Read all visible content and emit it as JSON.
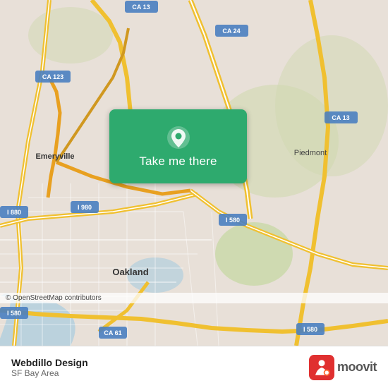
{
  "map": {
    "attribution": "© OpenStreetMap contributors",
    "region": "Oakland / SF Bay Area"
  },
  "button": {
    "label": "Take me there",
    "pin_icon": "location-pin-icon"
  },
  "bottom_bar": {
    "app_name": "Webdillo Design",
    "app_region": "SF Bay Area"
  },
  "roads": {
    "ca13_label": "CA 13",
    "ca24_label": "CA 24",
    "ca123_label": "CA 123",
    "i880_label": "I 880",
    "i980_label": "I 980",
    "i580_label": "I 580",
    "emeryville_label": "Emeryville",
    "oakland_label": "Oakland",
    "piedmont_label": "Piedmont"
  },
  "colors": {
    "button_bg": "#2eaa6e",
    "road_yellow": "#f5d949",
    "road_orange": "#e8a020",
    "map_bg": "#e8e0d8",
    "water": "#a8d4e6",
    "green_area": "#c8ddb0"
  }
}
